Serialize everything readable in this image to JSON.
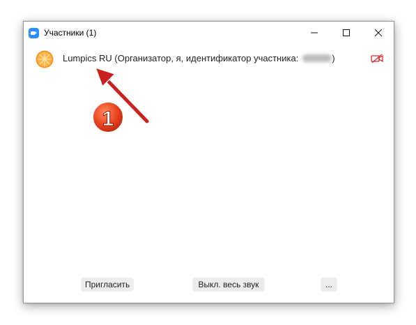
{
  "window": {
    "title": "Участники (1)",
    "app_icon": "zoom-camera-icon",
    "controls": [
      "minimize-icon",
      "maximize-icon",
      "close-icon"
    ]
  },
  "participants": [
    {
      "name_text": "Lumpics RU (Организатор, я, идентификатор участника:",
      "name_suffix": ")",
      "avatar": "orange-slice-avatar",
      "camera_status": "video-off-icon"
    }
  ],
  "footer": {
    "invite_label": "Пригласить",
    "mute_all_label": "Выкл. весь звук",
    "more_label": "..."
  },
  "annotation": {
    "step_number": "1",
    "colors": {
      "arrow": "#c9211e",
      "badge": "#e8411c"
    }
  }
}
